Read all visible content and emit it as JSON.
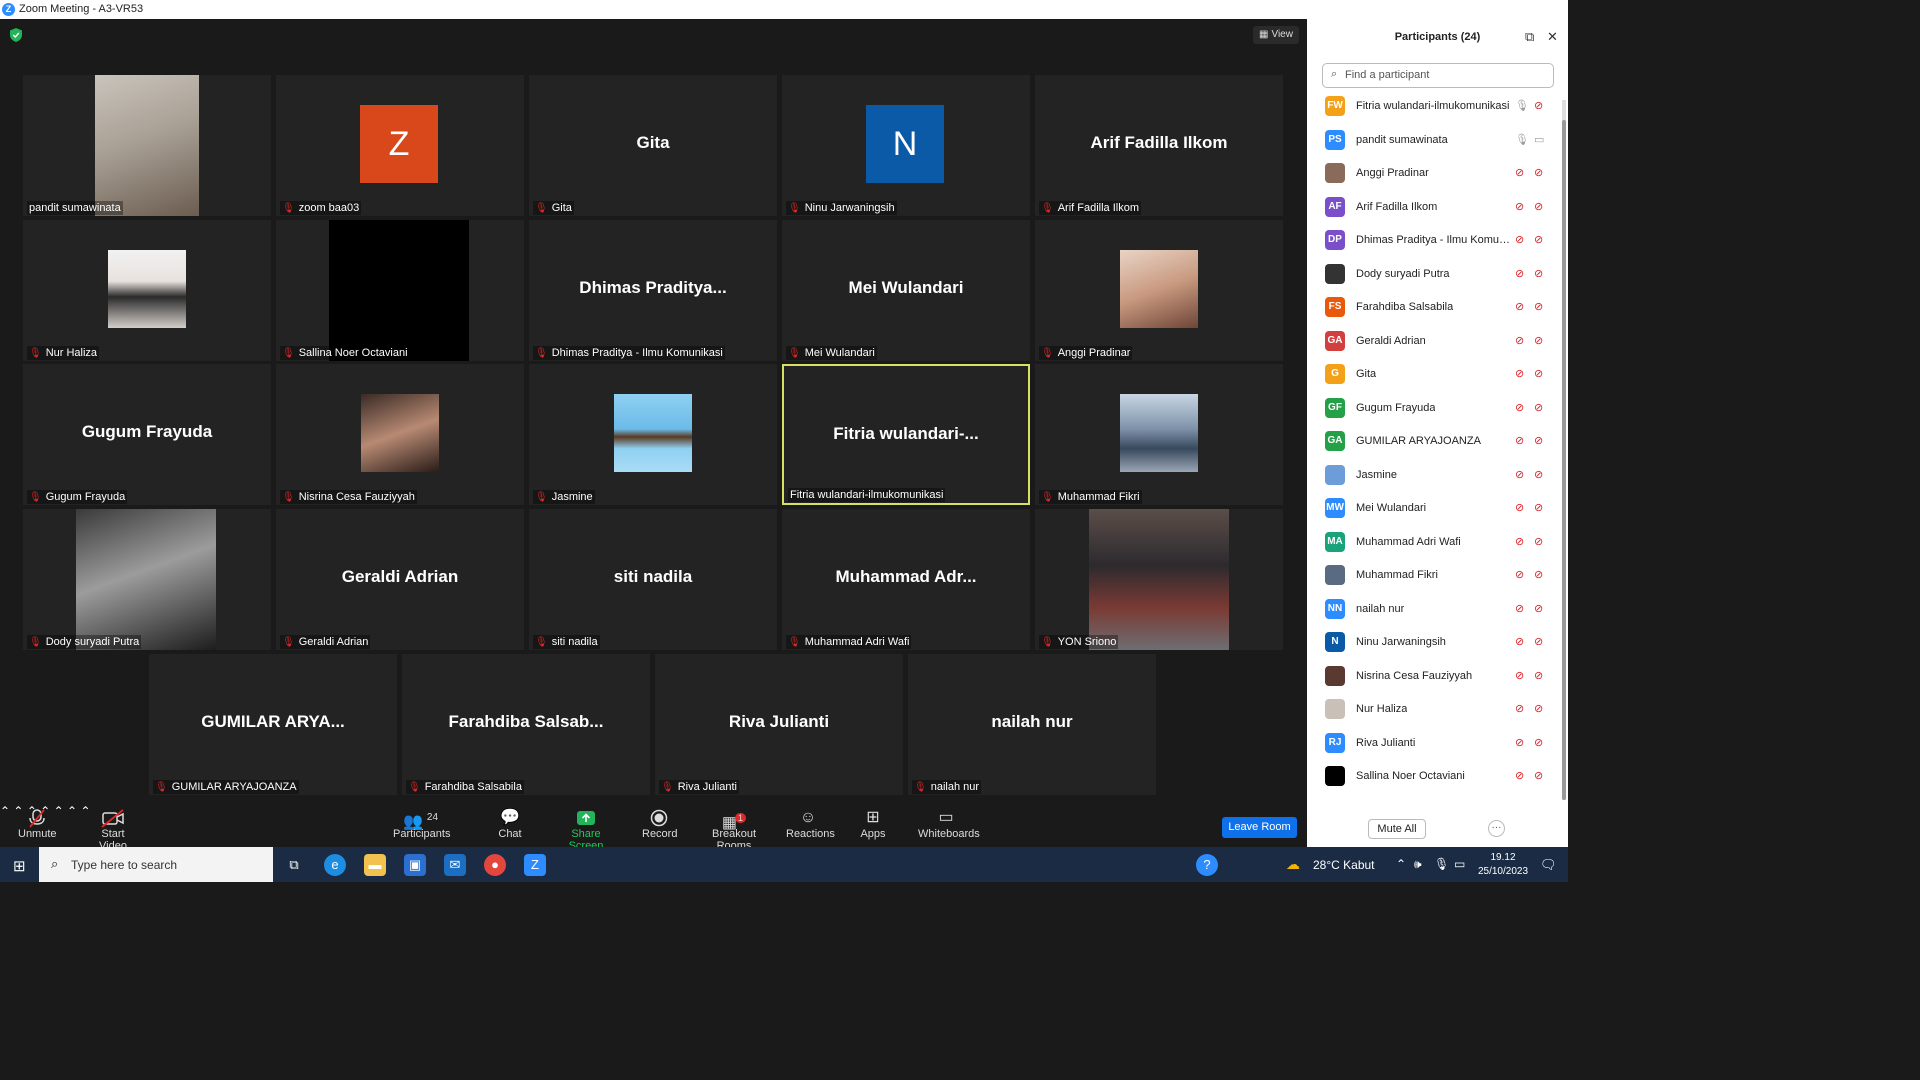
{
  "window": {
    "title": "Zoom Meeting - A3-VR53"
  },
  "view_label": "View",
  "tiles": [
    {
      "name": "pandit sumawinata",
      "display": "",
      "avatar_text": "",
      "avatar_color": "",
      "kind": "photo"
    },
    {
      "name": "zoom baa03",
      "display": "",
      "avatar_text": "Z",
      "avatar_color": "#d9481b",
      "kind": "avatar"
    },
    {
      "name": "Gita",
      "display": "Gita",
      "kind": "text"
    },
    {
      "name": "Ninu Jarwaningsih",
      "display": "",
      "avatar_text": "N",
      "avatar_color": "#0a5aa8",
      "kind": "avatar"
    },
    {
      "name": "Arif Fadilla Ilkom",
      "display": "Arif Fadilla Ilkom",
      "kind": "text"
    },
    {
      "name": "Nur Haliza",
      "kind": "photo"
    },
    {
      "name": "Sallina Noer Octaviani",
      "kind": "black"
    },
    {
      "name": "Dhimas Praditya - Ilmu Komunikasi",
      "display": "Dhimas  Praditya...",
      "kind": "text"
    },
    {
      "name": "Mei Wulandari",
      "display": "Mei Wulandari",
      "kind": "text"
    },
    {
      "name": "Anggi Pradinar",
      "kind": "photo"
    },
    {
      "name": "Gugum Frayuda",
      "display": "Gugum Frayuda",
      "kind": "text"
    },
    {
      "name": "Nisrina Cesa Fauziyyah",
      "kind": "photo"
    },
    {
      "name": "Jasmine",
      "kind": "photo"
    },
    {
      "name": "Fitria wulandari-ilmukomunikasi",
      "display": "Fitria  wulandari-...",
      "kind": "text"
    },
    {
      "name": "Muhammad Fikri",
      "kind": "photo"
    },
    {
      "name": "Dody suryadi Putra",
      "kind": "photo"
    },
    {
      "name": "Geraldi Adrian",
      "display": "Geraldi Adrian",
      "kind": "text"
    },
    {
      "name": "siti nadila",
      "display": "siti nadila",
      "kind": "text"
    },
    {
      "name": "Muhammad Adri Wafi",
      "display": "Muhammad  Adr...",
      "kind": "text"
    },
    {
      "name": "YON Sriono",
      "kind": "photo"
    },
    {
      "name": "GUMILAR ARYAJOANZA",
      "display": "GUMILAR  ARYA...",
      "kind": "text"
    },
    {
      "name": "Farahdiba Salsabila",
      "display": "Farahdiba  Salsab...",
      "kind": "text"
    },
    {
      "name": "Riva Julianti",
      "display": "Riva Julianti",
      "kind": "text"
    },
    {
      "name": "nailah nur",
      "display": "nailah nur",
      "kind": "text"
    }
  ],
  "toolbar": {
    "unmute": "Unmute",
    "start_video": "Start Video",
    "participants": "Participants",
    "participants_count": "24",
    "chat": "Chat",
    "share_screen": "Share Screen",
    "record": "Record",
    "breakout_rooms": "Breakout Rooms",
    "breakout_badge": "1",
    "reactions": "Reactions",
    "apps": "Apps",
    "whiteboards": "Whiteboards",
    "leave": "Leave Room"
  },
  "panel": {
    "title": "Participants (24)",
    "search_placeholder": "Find a participant",
    "mute_all": "Mute All",
    "more": "···",
    "participants": [
      {
        "initials": "FW",
        "color": "#f4a11a",
        "name": "Fitria wulandari-ilmukomunikasi",
        "mic": "on",
        "video": "off"
      },
      {
        "initials": "PS",
        "color": "#2d8cff",
        "name": "pandit sumawinata",
        "mic": "on",
        "video": "on"
      },
      {
        "initials": "",
        "color": "#8a6a5a",
        "name": "Anggi Pradinar",
        "mic": "off",
        "video": "off"
      },
      {
        "initials": "AF",
        "color": "#7b4fc9",
        "name": "Arif Fadilla Ilkom",
        "mic": "off",
        "video": "off"
      },
      {
        "initials": "DP",
        "color": "#7b4fc9",
        "name": "Dhimas Praditya - Ilmu Komuni...",
        "mic": "off",
        "video": "off"
      },
      {
        "initials": "",
        "color": "#333333",
        "name": "Dody suryadi Putra",
        "mic": "off",
        "video": "off"
      },
      {
        "initials": "FS",
        "color": "#e8590c",
        "name": "Farahdiba Salsabila",
        "mic": "off",
        "video": "off"
      },
      {
        "initials": "GA",
        "color": "#d23f3f",
        "name": "Geraldi Adrian",
        "mic": "off",
        "video": "off"
      },
      {
        "initials": "G",
        "color": "#f4a11a",
        "name": "Gita",
        "mic": "off",
        "video": "off"
      },
      {
        "initials": "GF",
        "color": "#24a148",
        "name": "Gugum Frayuda",
        "mic": "off",
        "video": "off"
      },
      {
        "initials": "GA",
        "color": "#24a148",
        "name": "GUMILAR ARYAJOANZA",
        "mic": "off",
        "video": "off"
      },
      {
        "initials": "",
        "color": "#6d9dd8",
        "name": "Jasmine",
        "mic": "off",
        "video": "off"
      },
      {
        "initials": "MW",
        "color": "#2d8cff",
        "name": "Mei Wulandari",
        "mic": "off",
        "video": "off"
      },
      {
        "initials": "MA",
        "color": "#1aa37a",
        "name": "Muhammad Adri Wafi",
        "mic": "off",
        "video": "off"
      },
      {
        "initials": "",
        "color": "#5a6a80",
        "name": "Muhammad Fikri",
        "mic": "off",
        "video": "off"
      },
      {
        "initials": "NN",
        "color": "#2d8cff",
        "name": "nailah nur",
        "mic": "off",
        "video": "off"
      },
      {
        "initials": "N",
        "color": "#0a5aa8",
        "name": "Ninu Jarwaningsih",
        "mic": "off",
        "video": "off"
      },
      {
        "initials": "",
        "color": "#5a3a30",
        "name": "Nisrina Cesa Fauziyyah",
        "mic": "off",
        "video": "off"
      },
      {
        "initials": "",
        "color": "#c9c0b8",
        "name": "Nur Haliza",
        "mic": "off",
        "video": "off"
      },
      {
        "initials": "RJ",
        "color": "#2d8cff",
        "name": "Riva Julianti",
        "mic": "off",
        "video": "off"
      },
      {
        "initials": "",
        "color": "#000000",
        "name": "Sallina Noer Octaviani",
        "mic": "off",
        "video": "off"
      }
    ]
  },
  "taskbar": {
    "search_placeholder": "Type here to search",
    "weather": "28°C  Kabut",
    "time": "19.12",
    "date": "25/10/2023"
  }
}
